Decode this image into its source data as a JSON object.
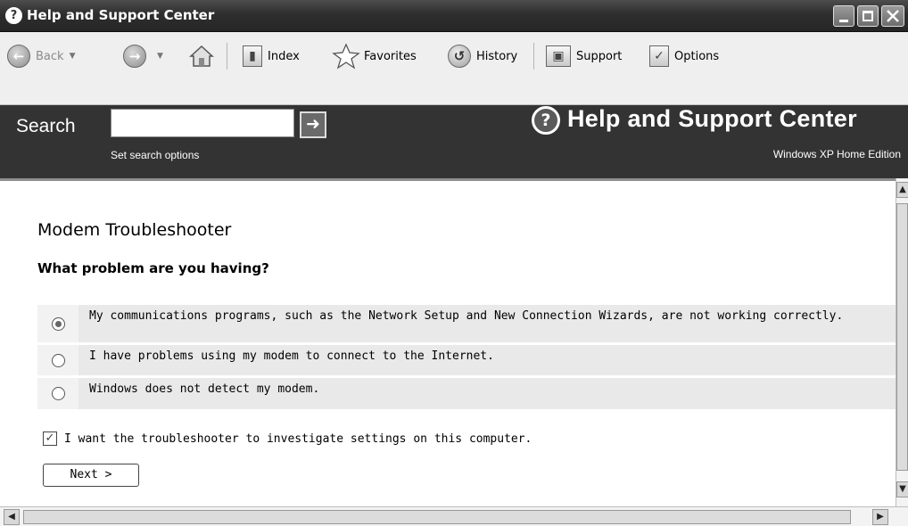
{
  "window": {
    "title": "Help and Support Center",
    "title_icon": "help-circle-icon"
  },
  "toolbar": {
    "back_label": "Back",
    "index_label": "Index",
    "favorites_label": "Favorites",
    "history_label": "History",
    "support_label": "Support",
    "options_label": "Options"
  },
  "header": {
    "search_label": "Search",
    "search_value": "",
    "search_go_icon": "arrow-right-icon",
    "search_options_link": "Set search options",
    "brand_title": "Help and Support Center",
    "edition": "Windows XP Home Edition"
  },
  "main": {
    "title": "Modem Troubleshooter",
    "question": "What problem are you having?",
    "options": [
      {
        "label": "My communications programs, such as the Network Setup and New Connection Wizards, are not working correctly.",
        "selected": true
      },
      {
        "label": "I have problems using my modem to connect to the Internet.",
        "selected": false
      },
      {
        "label": "Windows does not detect my modem.",
        "selected": false
      }
    ],
    "investigate_label": "I want the troubleshooter to investigate settings on this computer.",
    "investigate_checked": true,
    "next_label": "Next >"
  }
}
